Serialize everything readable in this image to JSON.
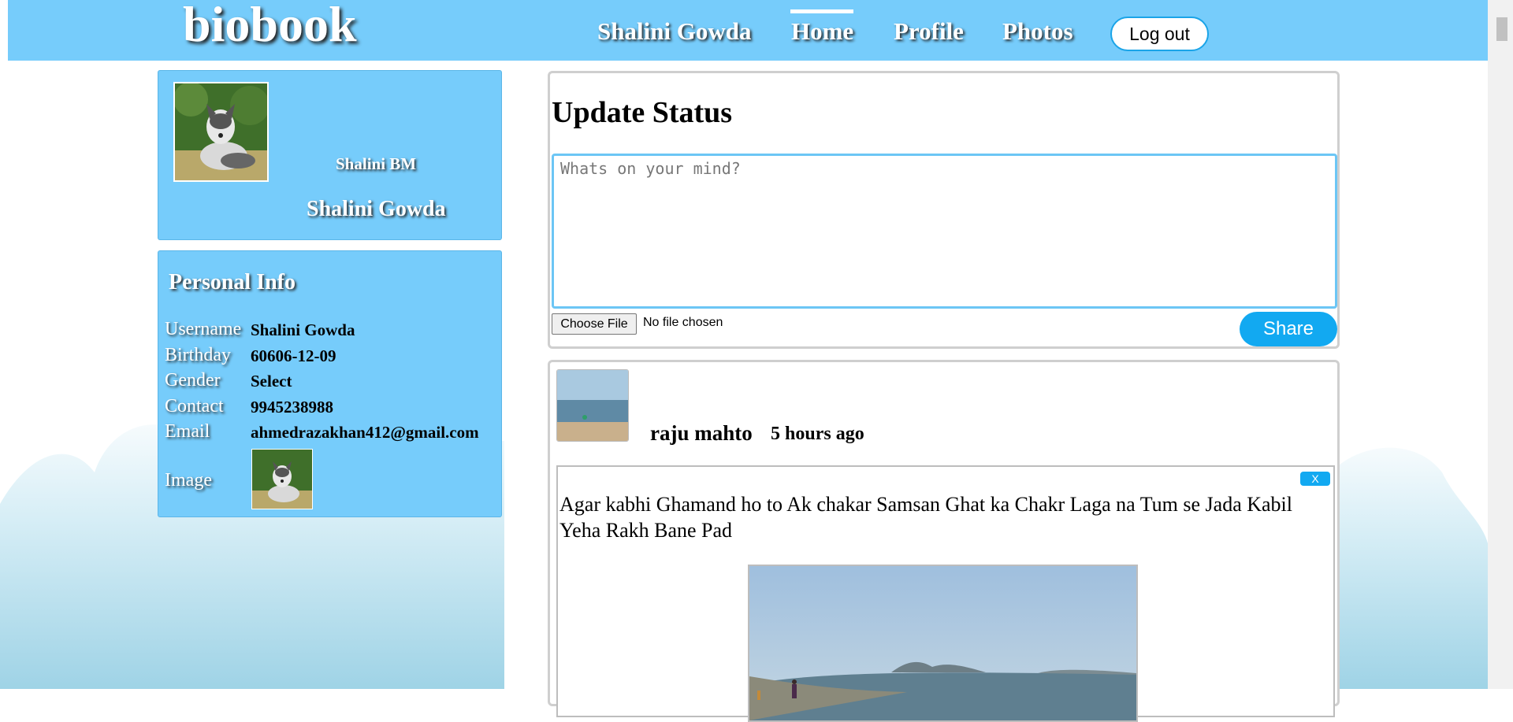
{
  "header": {
    "logo": "biobook",
    "nav": {
      "user": "Shalini Gowda",
      "home": "Home",
      "profile": "Profile",
      "photos": "Photos"
    },
    "logout_label": "Log out"
  },
  "profile_card": {
    "username": "Shalini BM",
    "name": "Shalini Gowda"
  },
  "personal_info": {
    "title": "Personal Info",
    "rows": [
      {
        "label": "Username",
        "value": "Shalini Gowda"
      },
      {
        "label": "Birthday",
        "value": "60606-12-09"
      },
      {
        "label": "Gender",
        "value": "Select"
      },
      {
        "label": "Contact",
        "value": "9945238988"
      },
      {
        "label": "Email",
        "value": "ahmedrazakhan412@gmail.com"
      }
    ],
    "image_label": "Image"
  },
  "status": {
    "title": "Update Status",
    "placeholder": "Whats on your mind?",
    "file_button": "Choose File",
    "file_status": "No file chosen",
    "share_label": "Share"
  },
  "post": {
    "author": "raju mahto",
    "time": "5 hours ago",
    "close_label": "X",
    "text": " Agar kabhi Ghamand ho to Ak chakar Samsan Ghat ka Chakr Laga na Tum se Jada Kabil Yeha Rakh Bane Pad"
  },
  "colors": {
    "header_bg": "#76ccfb",
    "card_bg": "#76ccfb",
    "accent_button": "#12a9f1"
  }
}
